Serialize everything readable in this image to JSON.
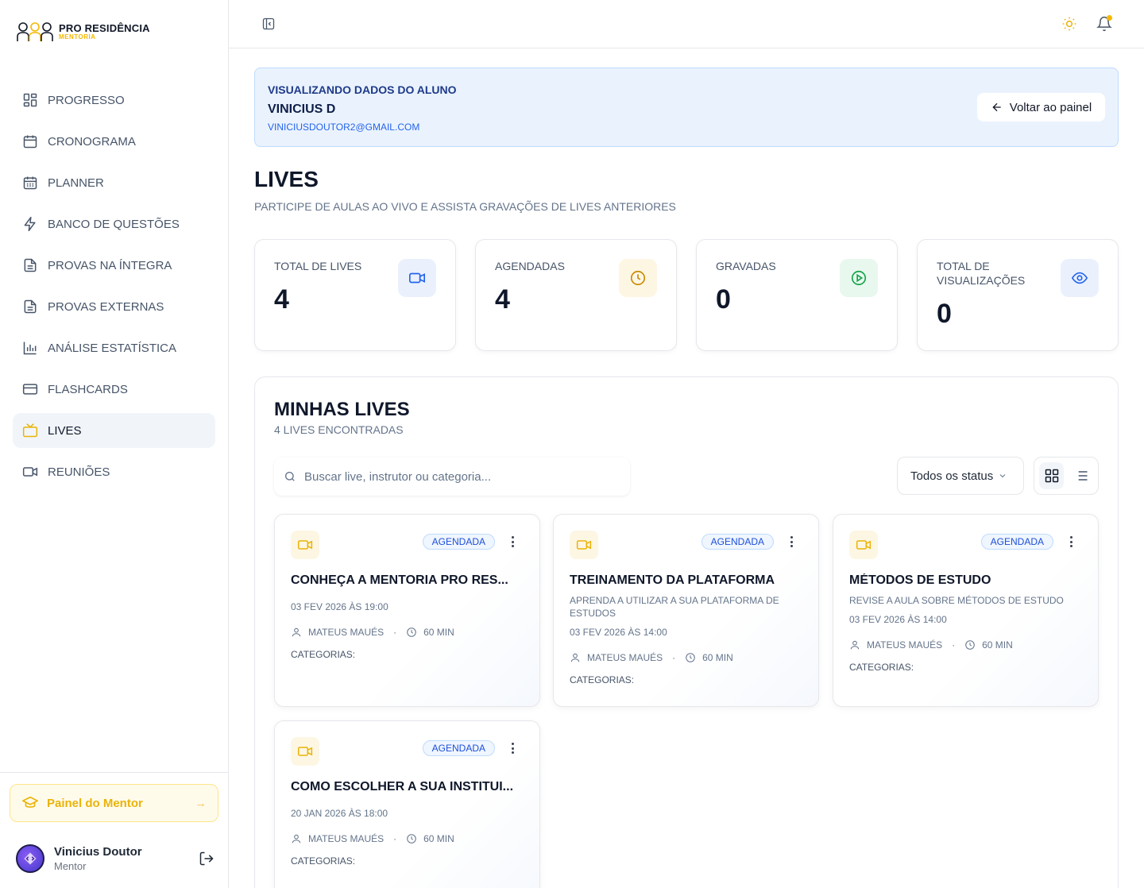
{
  "brand": {
    "title": "PRO RESIDÊNCIA",
    "subtitle": "MENTORIA",
    "accent": "#f5b800"
  },
  "sidebar": {
    "items": [
      {
        "label": "PROGRESSO",
        "icon": "grid-icon"
      },
      {
        "label": "CRONOGRAMA",
        "icon": "calendar-icon"
      },
      {
        "label": "PLANNER",
        "icon": "calendar-days-icon"
      },
      {
        "label": "BANCO DE QUESTÕES",
        "icon": "bolt-icon"
      },
      {
        "label": "PROVAS NA ÍNTEGRA",
        "icon": "document-icon"
      },
      {
        "label": "PROVAS EXTERNAS",
        "icon": "document-icon"
      },
      {
        "label": "ANÁLISE ESTATÍSTICA",
        "icon": "bar-chart-icon"
      },
      {
        "label": "FLASHCARDS",
        "icon": "card-icon"
      },
      {
        "label": "LIVES",
        "icon": "tv-icon",
        "active": true
      },
      {
        "label": "REUNIÕES",
        "icon": "video-icon"
      }
    ],
    "mentor_button": "Painel do Mentor",
    "user": {
      "name": "Vinicius Doutor",
      "role": "Mentor"
    }
  },
  "banner": {
    "label": "VISUALIZANDO DADOS DO ALUNO",
    "name": "VINICIUS D",
    "email": "VINICIUSDOUTOR2@GMAIL.COM",
    "back_button": "Voltar ao painel"
  },
  "page": {
    "title": "LIVES",
    "subtitle": "PARTICIPE DE AULAS AO VIVO E ASSISTA GRAVAÇÕES DE LIVES ANTERIORES"
  },
  "stats": [
    {
      "label": "TOTAL DE LIVES",
      "value": "4",
      "icon": "video-icon",
      "color": "#2563eb",
      "bg": "#eaf1fd"
    },
    {
      "label": "AGENDADAS",
      "value": "4",
      "icon": "clock-icon",
      "color": "#ca8a04",
      "bg": "#fdf6e3"
    },
    {
      "label": "GRAVADAS",
      "value": "0",
      "icon": "play-circle-icon",
      "color": "#16a34a",
      "bg": "#e8f8ee"
    },
    {
      "label": "TOTAL DE VISUALIZAÇÕES",
      "value": "0",
      "icon": "eye-icon",
      "color": "#2563eb",
      "bg": "#eaf1fd"
    }
  ],
  "panel": {
    "title": "MINHAS LIVES",
    "subtitle": "4 LIVES ENCONTRADAS",
    "search_placeholder": "Buscar live, instrutor ou categoria...",
    "status_filter": "Todos os status"
  },
  "lives": [
    {
      "title": "CONHEÇA A MENTORIA PRO RES...",
      "description": "",
      "date": "03 FEV 2026 ÀS 19:00",
      "instructor": "MATEUS MAUÉS",
      "duration": "60 MIN",
      "status": "AGENDADA",
      "categories": "CATEGORIAS:"
    },
    {
      "title": "TREINAMENTO DA PLATAFORMA",
      "description": "APRENDA A UTILIZAR A SUA PLATAFORMA DE ESTUDOS",
      "date": "03 FEV 2026 ÀS 14:00",
      "instructor": "MATEUS MAUÉS",
      "duration": "60 MIN",
      "status": "AGENDADA",
      "categories": "CATEGORIAS:"
    },
    {
      "title": "MÉTODOS DE ESTUDO",
      "description": "REVISE A AULA SOBRE MÉTODOS DE ESTUDO",
      "date": "03 FEV 2026 ÀS 14:00",
      "instructor": "MATEUS MAUÉS",
      "duration": "60 MIN",
      "status": "AGENDADA",
      "categories": "CATEGORIAS:"
    },
    {
      "title": "COMO ESCOLHER A SUA INSTITUI...",
      "description": "",
      "date": "20 JAN 2026 ÀS 18:00",
      "instructor": "MATEUS MAUÉS",
      "duration": "60 MIN",
      "status": "AGENDADA",
      "categories": "CATEGORIAS:"
    }
  ]
}
